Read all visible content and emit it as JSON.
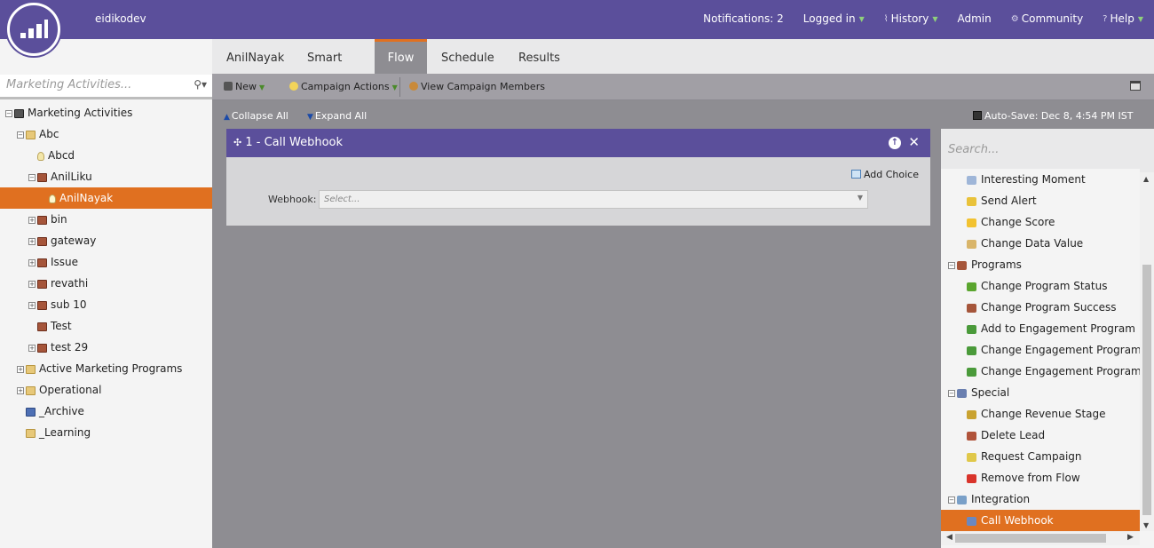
{
  "header": {
    "account": "eidikodev",
    "nav": [
      {
        "label": "Notifications: 2",
        "caret": false,
        "icon": ""
      },
      {
        "label": "Logged in",
        "caret": true,
        "icon": ""
      },
      {
        "label": "History",
        "caret": true,
        "icon": "history-icon"
      },
      {
        "label": "Admin",
        "caret": false,
        "icon": ""
      },
      {
        "label": "Community",
        "caret": false,
        "icon": "community-icon"
      },
      {
        "label": "Help",
        "caret": true,
        "icon": "help-icon"
      }
    ]
  },
  "left": {
    "search_placeholder": "Marketing Activities...",
    "tree": [
      {
        "label": "Marketing Activities",
        "indent": 0,
        "expander": "minus",
        "icon": "root"
      },
      {
        "label": "Abc",
        "indent": 1,
        "expander": "minus",
        "icon": "folder"
      },
      {
        "label": "Abcd",
        "indent": 2,
        "expander": "",
        "icon": "bulb"
      },
      {
        "label": "AnilLiku",
        "indent": 2,
        "expander": "minus",
        "icon": "campaign"
      },
      {
        "label": "AnilNayak",
        "indent": 3,
        "expander": "",
        "icon": "bulb",
        "selected": true
      },
      {
        "label": "bin",
        "indent": 2,
        "expander": "plus",
        "icon": "campaign"
      },
      {
        "label": "gateway",
        "indent": 2,
        "expander": "plus",
        "icon": "campaign"
      },
      {
        "label": "Issue",
        "indent": 2,
        "expander": "plus",
        "icon": "campaign"
      },
      {
        "label": "revathi",
        "indent": 2,
        "expander": "plus",
        "icon": "campaign"
      },
      {
        "label": "sub 10",
        "indent": 2,
        "expander": "plus",
        "icon": "campaign"
      },
      {
        "label": "Test",
        "indent": 2,
        "expander": "",
        "icon": "campaign"
      },
      {
        "label": "test 29",
        "indent": 2,
        "expander": "plus",
        "icon": "campaign"
      },
      {
        "label": "Active Marketing Programs",
        "indent": 1,
        "expander": "plus",
        "icon": "folder"
      },
      {
        "label": "Operational",
        "indent": 1,
        "expander": "plus",
        "icon": "folder"
      },
      {
        "label": "_Archive",
        "indent": 1,
        "expander": "",
        "icon": "archive"
      },
      {
        "label": "_Learning",
        "indent": 1,
        "expander": "",
        "icon": "folder"
      }
    ]
  },
  "tabs": [
    {
      "label": "AnilNayak",
      "active": false
    },
    {
      "label": "Smart List",
      "active": false
    },
    {
      "label": "Flow",
      "active": true
    },
    {
      "label": "Schedule",
      "active": false
    },
    {
      "label": "Results",
      "active": false
    }
  ],
  "toolbar": {
    "new_label": "New",
    "campaign_actions_label": "Campaign Actions",
    "view_members_label": "View Campaign Members"
  },
  "canvas": {
    "collapse_all": "Collapse All",
    "expand_all": "Expand All",
    "autosave": "Auto-Save: Dec 8, 4:54 PM IST"
  },
  "flow_step": {
    "title": "1 - Call Webhook",
    "add_choice": "Add Choice",
    "webhook_label": "Webhook:",
    "webhook_placeholder": "Select..."
  },
  "palette": {
    "search_placeholder": "Search...",
    "items": [
      {
        "label": "Interesting Moment",
        "type": "leaf",
        "color": "#9fb6d8"
      },
      {
        "label": "Send Alert",
        "type": "leaf",
        "color": "#e9c23a"
      },
      {
        "label": "Change Score",
        "type": "leaf",
        "color": "#f2c230"
      },
      {
        "label": "Change Data Value",
        "type": "leaf",
        "color": "#d9b56a"
      },
      {
        "label": "Programs",
        "type": "group",
        "color": "#a5553a"
      },
      {
        "label": "Change Program Status",
        "type": "leaf",
        "color": "#5aa52e"
      },
      {
        "label": "Change Program Success",
        "type": "leaf",
        "color": "#a5553a"
      },
      {
        "label": "Add to Engagement Program",
        "type": "leaf",
        "color": "#4a9a3a"
      },
      {
        "label": "Change Engagement Program Cad",
        "type": "leaf",
        "color": "#4a9a3a"
      },
      {
        "label": "Change Engagement Program Stre",
        "type": "leaf",
        "color": "#4a9a3a"
      },
      {
        "label": "Special",
        "type": "group",
        "color": "#6a7fb0"
      },
      {
        "label": "Change Revenue Stage",
        "type": "leaf",
        "color": "#c9a230"
      },
      {
        "label": "Delete Lead",
        "type": "leaf",
        "color": "#b0533a"
      },
      {
        "label": "Request Campaign",
        "type": "leaf",
        "color": "#e0c84a"
      },
      {
        "label": "Remove from Flow",
        "type": "leaf",
        "color": "#d9342b"
      },
      {
        "label": "Integration",
        "type": "group",
        "color": "#7aa0c8"
      },
      {
        "label": "Call Webhook",
        "type": "leaf",
        "color": "#6a88c0",
        "selected": true
      }
    ]
  },
  "colors": {
    "brand_purple": "#5b4f9b",
    "accent_orange": "#e07020",
    "canvas_gray": "#8e8d92"
  }
}
